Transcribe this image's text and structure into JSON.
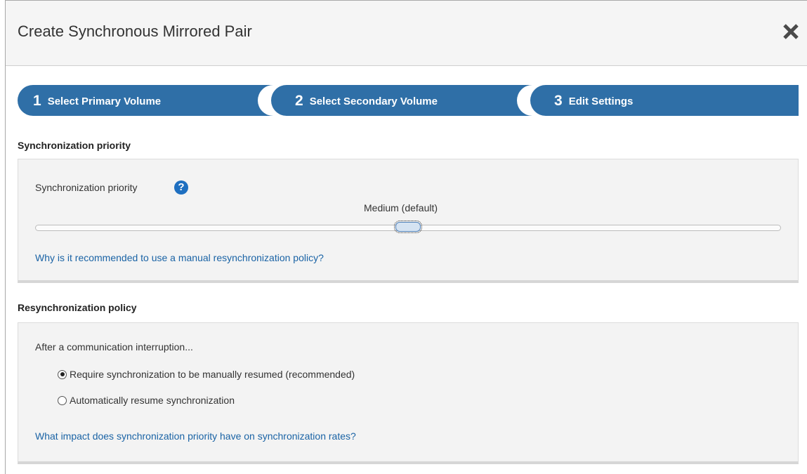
{
  "dialog": {
    "title": "Create Synchronous Mirrored Pair",
    "close_icon": "close-x-icon"
  },
  "wizard": {
    "accent_color": "#2f6fa7",
    "steps": [
      {
        "number": "1",
        "label": "Select Primary Volume"
      },
      {
        "number": "2",
        "label": "Select Secondary Volume"
      },
      {
        "number": "3",
        "label": "Edit Settings"
      }
    ],
    "active_step": 3
  },
  "sync_priority": {
    "heading": "Synchronization priority",
    "label": "Synchronization priority",
    "help_icon": "question-circle-icon",
    "help_glyph": "?",
    "value_label": "Medium (default)",
    "slider_level_percent": 50,
    "link": "Why is it recommended to use a manual resynchronization policy?"
  },
  "resync_policy": {
    "heading": "Resynchronization policy",
    "intro": "After a communication interruption...",
    "options": [
      {
        "label": "Require synchronization to be manually resumed (recommended)",
        "checked": true
      },
      {
        "label": "Automatically resume synchronization",
        "checked": false
      }
    ],
    "link": "What impact does synchronization priority have on synchronization rates?"
  }
}
